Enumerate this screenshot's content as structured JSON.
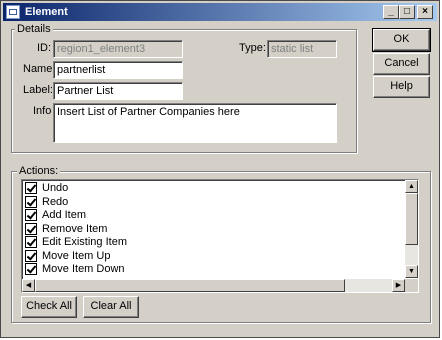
{
  "window": {
    "title": "Element",
    "minimize_glyph": "_",
    "maximize_glyph": "□",
    "close_glyph": "×"
  },
  "details": {
    "group_label": "Details",
    "id_label": "ID:",
    "id_value": "region1_element3",
    "type_label": "Type:",
    "type_value": "static list",
    "name_label": "Name:",
    "name_value": "partnerlist",
    "label_label": "Label:",
    "label_value": "Partner List",
    "info_label": "Info",
    "info_value": "Insert List of Partner Companies here"
  },
  "dialog_buttons": {
    "ok": "OK",
    "cancel": "Cancel",
    "help": "Help"
  },
  "actions": {
    "group_label": "Actions:",
    "items": [
      {
        "label": "Undo",
        "checked": true
      },
      {
        "label": "Redo",
        "checked": true
      },
      {
        "label": "Add Item",
        "checked": true
      },
      {
        "label": "Remove Item",
        "checked": true
      },
      {
        "label": "Edit Existing Item",
        "checked": true
      },
      {
        "label": "Move Item Up",
        "checked": true
      },
      {
        "label": "Move Item Down",
        "checked": true
      }
    ],
    "check_all": "Check All",
    "clear_all": "Clear All"
  },
  "scrollbar_icons": {
    "up": "▲",
    "down": "▼",
    "left": "◀",
    "right": "▶"
  }
}
